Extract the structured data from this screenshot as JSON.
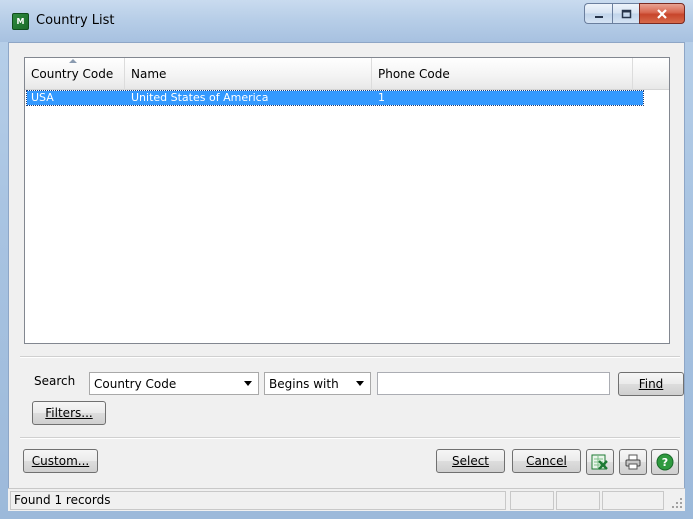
{
  "window": {
    "title": "Country List",
    "app_icon": "M"
  },
  "grid": {
    "columns": [
      "Country Code",
      "Name",
      "Phone Code",
      ""
    ],
    "rows": [
      {
        "country_code": "USA",
        "name": "United States of America",
        "phone_code": "1",
        "selected": true
      }
    ]
  },
  "search": {
    "label": "Search",
    "field": "Country Code",
    "operator": "Begins with",
    "value": "",
    "find_label": "Find",
    "filters_label": "Filters..."
  },
  "footer": {
    "custom_label": "Custom...",
    "select_label": "Select",
    "cancel_label": "Cancel",
    "icons": [
      "excel-export-icon",
      "print-icon",
      "help-icon"
    ]
  },
  "status": {
    "text": "Found 1 records"
  },
  "colors": {
    "selection": "#3399ff",
    "excel_green": "#1e7a34",
    "help_green": "#2f9a3f",
    "close_red": "#c7452b"
  }
}
